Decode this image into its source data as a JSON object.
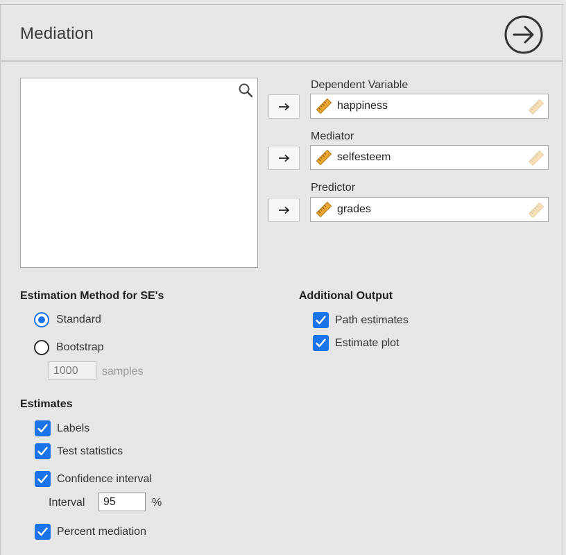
{
  "header": {
    "title": "Mediation"
  },
  "variables": {
    "dependent": {
      "label": "Dependent Variable",
      "value": "happiness"
    },
    "mediator": {
      "label": "Mediator",
      "value": "selfesteem"
    },
    "predictor": {
      "label": "Predictor",
      "value": "grades"
    }
  },
  "estimation": {
    "heading": "Estimation Method for SE's",
    "standard_label": "Standard",
    "bootstrap_label": "Bootstrap",
    "selected": "Standard",
    "samples_value": "1000",
    "samples_label": "samples"
  },
  "additional_output": {
    "heading": "Additional Output",
    "path_estimates_label": "Path estimates",
    "estimate_plot_label": "Estimate plot"
  },
  "estimates": {
    "heading": "Estimates",
    "labels_label": "Labels",
    "test_statistics_label": "Test statistics",
    "confidence_interval_label": "Confidence interval",
    "interval_label": "Interval",
    "interval_value": "95",
    "interval_unit": "%",
    "percent_mediation_label": "Percent mediation"
  },
  "colors": {
    "accent": "#1a73e8",
    "ruler": "#e8a531"
  }
}
